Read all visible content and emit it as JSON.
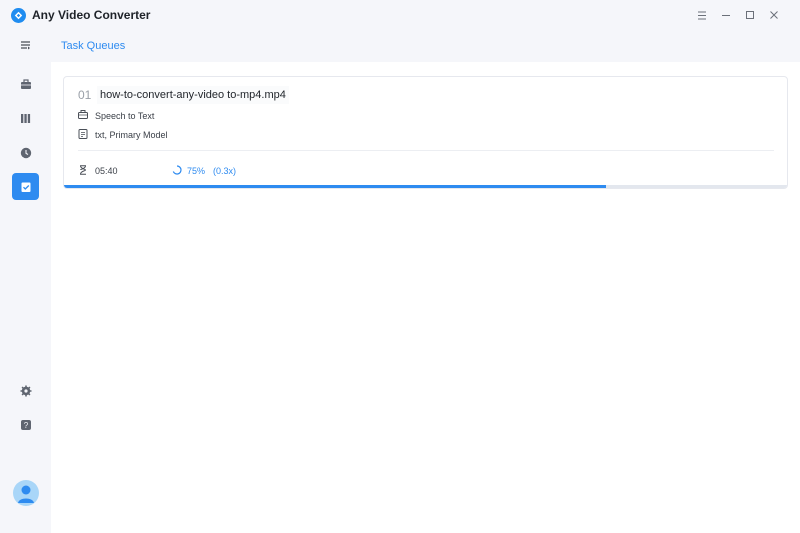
{
  "window": {
    "title": "Any Video Converter",
    "controls": [
      "menu-icon",
      "minimize-icon",
      "maximize-icon",
      "close-icon"
    ]
  },
  "sidebar": {
    "items": [
      {
        "icon": "collapse-icon",
        "active": false
      },
      {
        "icon": "toolbox-icon",
        "active": false
      },
      {
        "icon": "library-icon",
        "active": false
      },
      {
        "icon": "history-icon",
        "active": false
      },
      {
        "icon": "task-queue-icon",
        "active": true
      },
      {
        "icon": "settings-icon",
        "active": false
      },
      {
        "icon": "help-icon",
        "active": false
      }
    ],
    "avatar": "avatar-icon"
  },
  "main": {
    "page_title": "Task Queues",
    "tasks": [
      {
        "index": "01",
        "filename": "how-to-convert-any-video to-mp4.mp4",
        "operation": "Speech to Text",
        "output": "txt, Primary Model",
        "duration": "05:40",
        "percent_label": "75%",
        "speed": "(0.3x)",
        "progress": 0.75
      }
    ]
  },
  "colors": {
    "accent": "#2e8bf0",
    "sidebar_bg": "#f5f6fa",
    "content_bg": "#ffffff"
  }
}
